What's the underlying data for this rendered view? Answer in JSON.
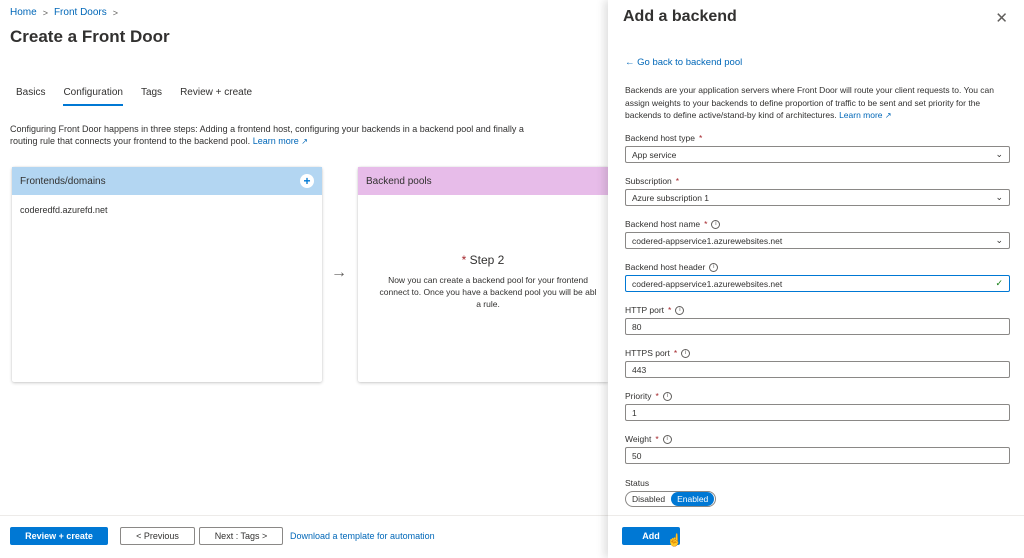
{
  "breadcrumb": {
    "home": "Home",
    "sep": ">",
    "current": "Front Doors",
    "sep2": ">"
  },
  "page_title": "Create a Front Door",
  "tabs": [
    {
      "label": "Basics"
    },
    {
      "label": "Configuration"
    },
    {
      "label": "Tags"
    },
    {
      "label": "Review + create"
    }
  ],
  "intro": {
    "text": "Configuring Front Door happens in three steps: Adding a frontend host, configuring your backends in a backend pool and finally a routing rule that connects your frontend to the backend pool.",
    "learn_more": "Learn more"
  },
  "frontends": {
    "title": "Frontends/domains",
    "item": "coderedfd.azurefd.net",
    "add_icon": "plus-circle-icon"
  },
  "backend_pools": {
    "title": "Backend pools",
    "step_marker": "*",
    "step": "Step 2",
    "desc_line1": "Now you can create a backend pool for your frontend",
    "desc_line2": "connect to. Once you have a backend pool you will be abl",
    "desc_line3": "a rule."
  },
  "arrow": "→",
  "bottom": {
    "review_create": "Review + create",
    "previous": "< Previous",
    "next": "Next : Tags >",
    "download": "Download a template for automation"
  },
  "panel": {
    "title": "Add a backend",
    "close": "✕",
    "back_link": "← Go back to backend pool",
    "desc": "Backends are your application servers where Front Door will route your client requests to. You can assign weights to your backends to define proportion of traffic to be sent and set priority for the backends to define active/stand-by kind of architectures.",
    "learn_more": "Learn more",
    "fields": {
      "host_type": {
        "label": "Backend host type",
        "req": "*",
        "value": "App service"
      },
      "subscription": {
        "label": "Subscription",
        "req": "*",
        "value": "Azure subscription 1"
      },
      "host_name": {
        "label": "Backend host name",
        "req": "*",
        "value": "codered-appservice1.azurewebsites.net"
      },
      "host_header": {
        "label": "Backend host header",
        "value": "codered-appservice1.azurewebsites.net"
      },
      "http_port": {
        "label": "HTTP port",
        "req": "*",
        "value": "80"
      },
      "https_port": {
        "label": "HTTPS port",
        "req": "*",
        "value": "443"
      },
      "priority": {
        "label": "Priority",
        "req": "*",
        "value": "1"
      },
      "weight": {
        "label": "Weight",
        "req": "*",
        "value": "50"
      }
    },
    "status": {
      "label": "Status",
      "disabled": "Disabled",
      "enabled": "Enabled",
      "selected": "Enabled"
    },
    "add": "Add"
  },
  "icons": {
    "chevron": "chevron-down-icon",
    "info": "info-icon",
    "check": "check-icon",
    "close": "close-icon"
  },
  "colors": {
    "accent": "#0078d4",
    "frontends_header": "#b3d6f2",
    "backends_header": "#e7bce9",
    "required": "#a4262c"
  }
}
